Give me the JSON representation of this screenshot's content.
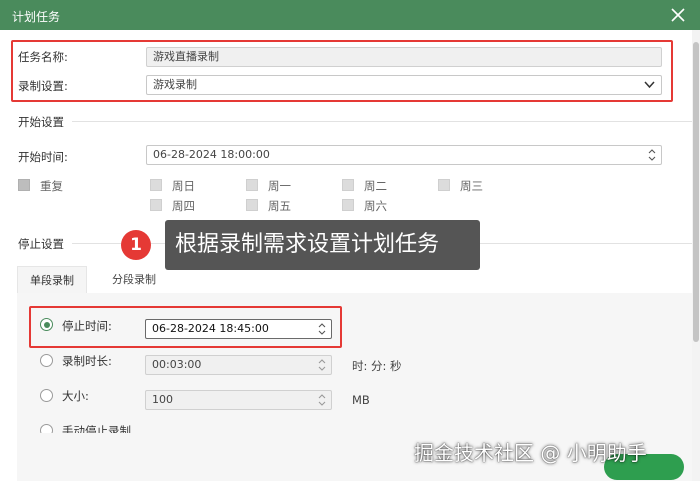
{
  "window": {
    "title": "计划任务",
    "accent": "#4a8b5c"
  },
  "task": {
    "name_label": "任务名称:",
    "name_value": "游戏直播录制",
    "record_label": "录制设置:",
    "record_value": "游戏录制"
  },
  "start": {
    "section": "开始设置",
    "time_label": "开始时间:",
    "time_value": "06-28-2024 18:00:00",
    "repeat_label": "重复",
    "days": [
      "周日",
      "周一",
      "周二",
      "周三",
      "周四",
      "周五",
      "周六"
    ]
  },
  "stop": {
    "section": "停止设置",
    "tabs": [
      "单段录制",
      "分段录制"
    ],
    "stop_time_label": "停止时间:",
    "stop_time_value": "06-28-2024 18:45:00",
    "duration_label": "录制时长:",
    "duration_value": "00:03:00",
    "duration_unit": "时: 分: 秒",
    "size_label": "大小:",
    "size_value": "100",
    "size_unit": "MB",
    "manual_label": "手动停止录制"
  },
  "callout": {
    "number": "1",
    "text": "根据录制需求设置计划任务"
  },
  "watermark": "掘金技术社区 @ 小明助手"
}
